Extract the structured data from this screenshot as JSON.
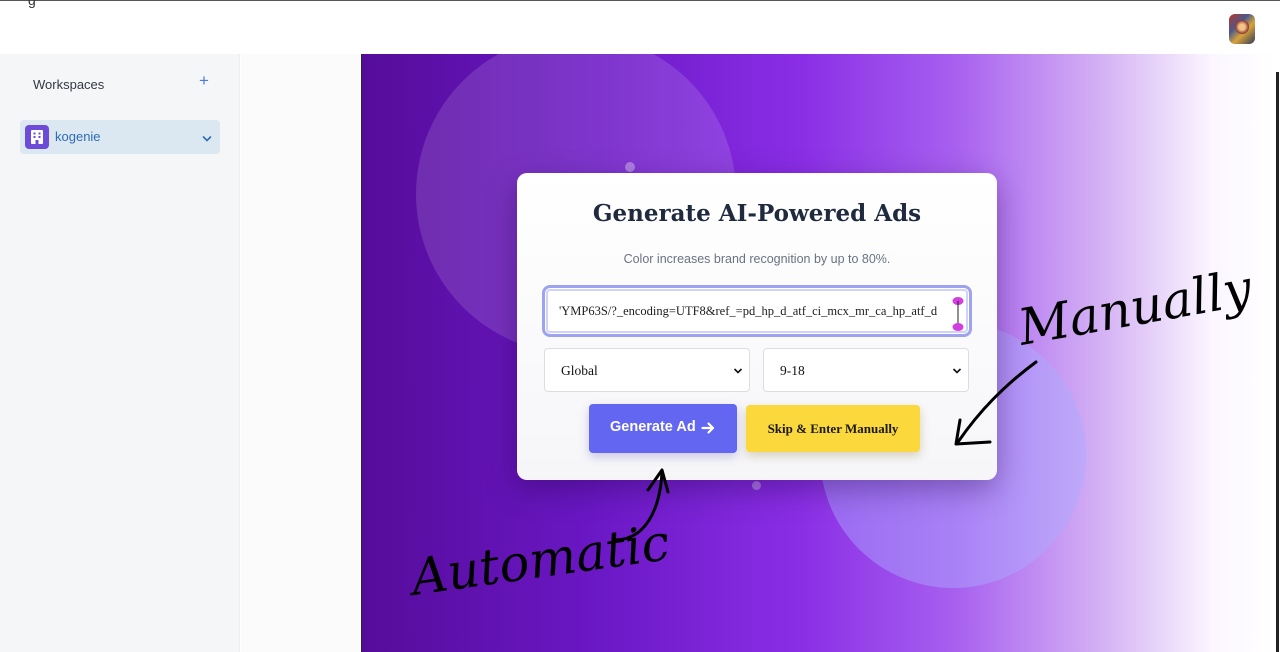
{
  "header": {
    "partial_title": "g",
    "avatar": "user-avatar"
  },
  "sidebar": {
    "title": "Workspaces",
    "add_label": "+",
    "workspace": {
      "name": "kogenie",
      "icon": "building-icon"
    }
  },
  "card": {
    "title": "Generate AI-Powered Ads",
    "subtitle": "Color increases brand recognition by up to 80%.",
    "url_value": "'YMP63S/?_encoding=UTF8&ref_=pd_hp_d_atf_ci_mcx_mr_ca_hp_atf_d",
    "region_select": {
      "selected": "Global"
    },
    "age_select": {
      "selected": "9-18"
    },
    "generate_button": "Generate Ad",
    "skip_button": "Skip & Enter Manually"
  },
  "annotations": {
    "left_label": "Automatic",
    "right_label": "Manually"
  },
  "colors": {
    "accent": "#6366f1",
    "skip": "#fbd83c",
    "hero_dark": "#560c9a",
    "hero_mid": "#8a2ee6",
    "sidebar_active": "#dbe7f1"
  }
}
